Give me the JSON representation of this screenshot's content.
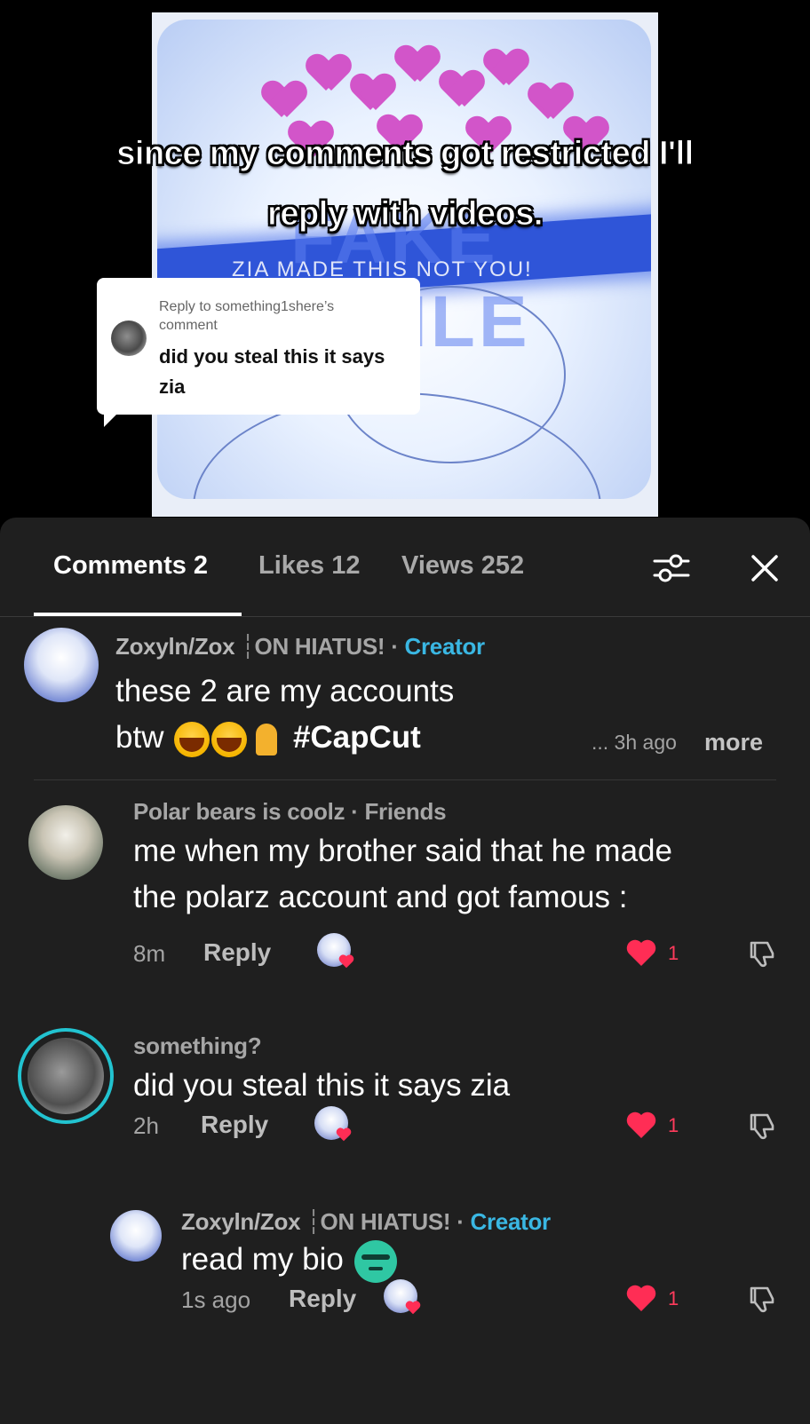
{
  "video": {
    "caption_line1": "since my comments got restricted I'll",
    "caption_line2": "reply with videos.",
    "watermark": "ZIA MADE THIS NOT YOU!",
    "banner_word": "FAKE SMILE",
    "reply_sticker": {
      "label": "Reply to something1shere’s comment",
      "text": "did you steal this it says zia"
    }
  },
  "tabs": [
    {
      "label": "Comments 2"
    },
    {
      "label": "Likes 12"
    },
    {
      "label": "Views 252"
    }
  ],
  "icons": {
    "filter": "filter-sliders-icon",
    "close": "close-icon",
    "heart": "heart-icon",
    "dislike": "thumbs-down-icon"
  },
  "colors": {
    "accent_creator": "#3ab7e3",
    "like_red": "#ff2d55",
    "sheet_bg": "#1f1f1f",
    "ring": "#22c3d0"
  },
  "comments": [
    {
      "author": "Zoxyln/Zox",
      "author_suffix": "ON HIATUS!",
      "role": "Creator",
      "line1": "these 2 are my accounts",
      "line2": "btw",
      "hashtag": "#CapCut",
      "time": "... 3h ago",
      "more": "more"
    },
    {
      "author": "Polar bears is coolz",
      "role": "Friends",
      "line1": "me when my brother said that he made",
      "line2": "the polarz account and got famous :",
      "time": "8m",
      "reply": "Reply",
      "likes": "1"
    },
    {
      "author": "something?",
      "line1": "did you steal this it says zia",
      "time": "2h",
      "reply": "Reply",
      "likes": "1"
    },
    {
      "author": "Zoxyln/Zox",
      "author_suffix": "ON HIATUS!",
      "role": "Creator",
      "line1": "read my bio",
      "time": "1s ago",
      "reply": "Reply",
      "likes": "1"
    }
  ]
}
